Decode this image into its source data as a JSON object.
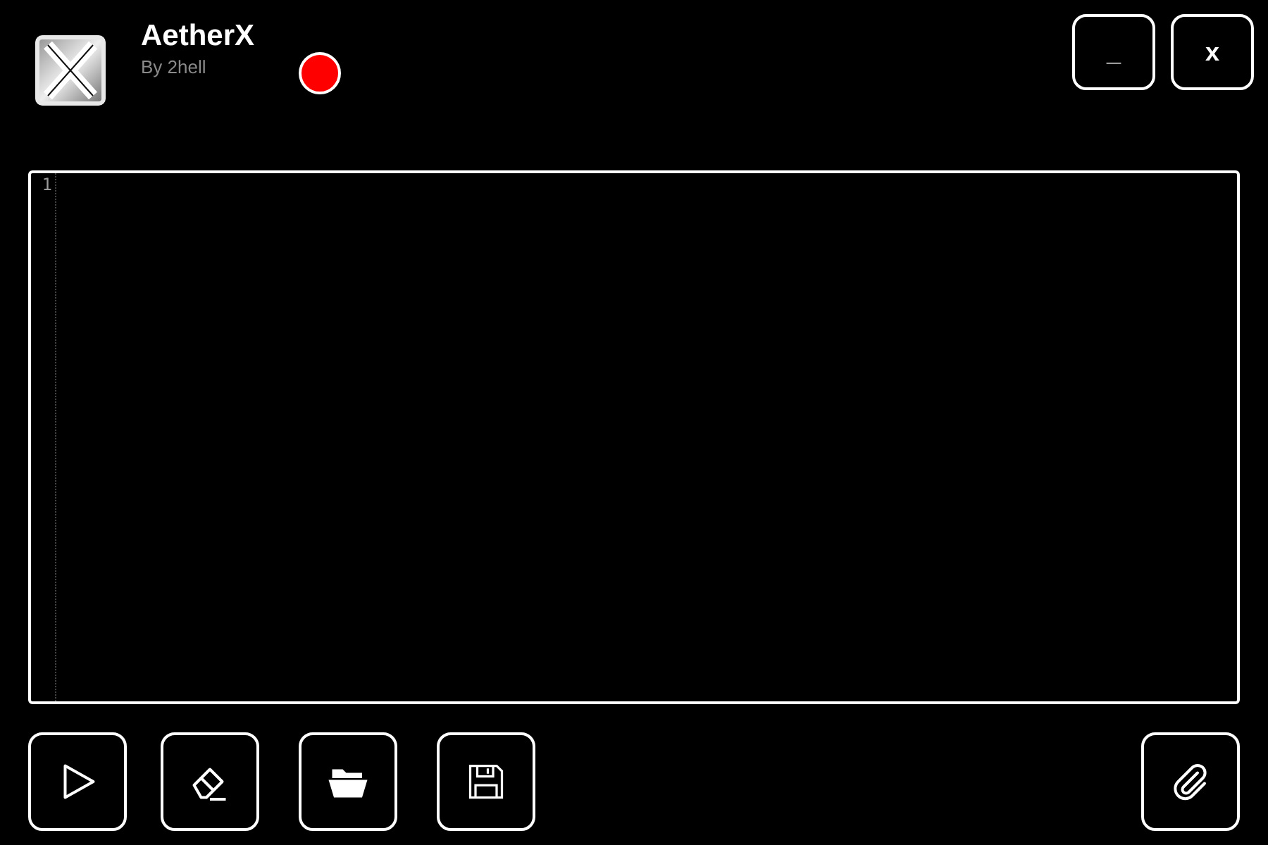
{
  "header": {
    "title": "AetherX",
    "subtitle": "By 2hell"
  },
  "window_buttons": [
    {
      "label": "_"
    },
    {
      "label": "x"
    }
  ],
  "editor": {
    "line_numbers": [
      "1"
    ]
  },
  "toolbar": [
    {
      "kind": "play"
    },
    {
      "kind": "eraser"
    },
    {
      "kind": "folder"
    },
    {
      "kind": "save"
    },
    {
      "kind": "clip"
    }
  ]
}
